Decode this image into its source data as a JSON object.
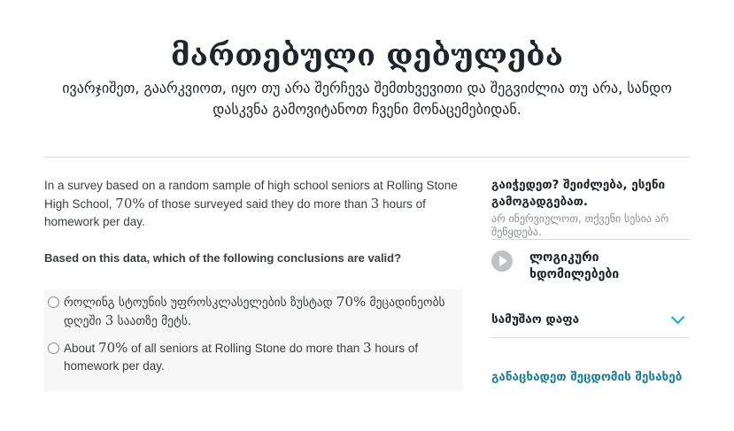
{
  "header": {
    "title": "მართებული დებულება",
    "subtitle": "ივარჯიშეთ, გაარკვიოთ, იყო თუ არა შერჩევა შემთხვევითი და შეგვიძლია თუ არა, სანდო დასკვნა გამოვიტანოთ ჩვენი მონაცემებიდან."
  },
  "question": {
    "text_part1": "In a survey based on a random sample of high school seniors at Rolling Stone High School, ",
    "percent": "70%",
    "text_part2": " of those surveyed said they do more than ",
    "hours": "3",
    "text_part3": " hours of homework per day.",
    "prompt": "Based on this data, which of the following conclusions are valid?"
  },
  "choices": [
    {
      "part1": "როლინგ სტოუნის უფროსკლასელების ზუსტად ",
      "math1": "70%",
      "part2": " მეცადინეობს დღეში ",
      "math2": "3",
      "part3": " საათზე მეტს."
    },
    {
      "part1": "About ",
      "math1": "70%",
      "part2": " of all seniors at Rolling Stone do more than ",
      "math2": "3",
      "part3": " hours of homework per day."
    }
  ],
  "sidebar": {
    "stuck_title": "გაიჭედეთ? შეიძლება, ესენი გამოგადგებათ.",
    "stuck_subtitle": "არ ინერვიულოთ, თქვენი სესია არ შეწყდება.",
    "video_label": "ლოგიკური ხდომილებები",
    "scratchpad_label": "სამუშაო დაფა",
    "report_label": "განაცხადეთ შეცდომის შესახებ"
  },
  "colors": {
    "accent": "#11a8c4",
    "link": "#1c7f91",
    "choice_bg": "#f7f7f7"
  }
}
